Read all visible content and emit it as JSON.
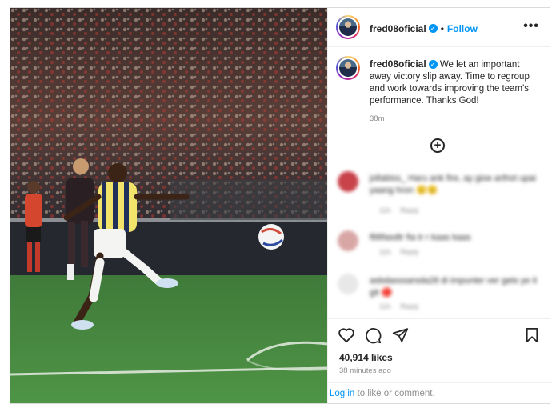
{
  "post": {
    "username": "fred08oficial",
    "verified_mark": "✓",
    "separator": "•",
    "follow_label": "Follow",
    "more_label": "•••",
    "caption": "We let an important away victory slip away. Time to regroup and work towards improving the team's performance. Thanks God!",
    "caption_time": "38m",
    "likes": "40,914 likes",
    "post_time": "38 minutes ago"
  },
  "comments": [
    {
      "text": "jollabiss_ Haru ank fire, ay gioe arthot upai yaang hron 😟😟",
      "avatar_color": "#c9434b",
      "meta": [
        "11h",
        "Reply"
      ]
    },
    {
      "text": "f88fasdtr fia tr r kaas kaas",
      "avatar_color": "#d9a6a6",
      "meta": [
        "11h",
        "Reply"
      ]
    },
    {
      "text": "asbdasssarsda28 di impunter ver gets ye it git 🔴",
      "avatar_color": "#e8e8e8",
      "meta": [
        "11h",
        "Reply"
      ]
    }
  ],
  "footer": {
    "login_link": "Log in",
    "login_rest": " to like or comment."
  },
  "icons": {
    "like": "heart-icon",
    "comment": "comment-icon",
    "share": "share-icon",
    "save": "bookmark-icon",
    "add_comment": "plus-circle-icon"
  },
  "colors": {
    "accent": "#0095f6",
    "text": "#262626",
    "muted": "#8e8e8e",
    "border": "#dbdbdb"
  }
}
